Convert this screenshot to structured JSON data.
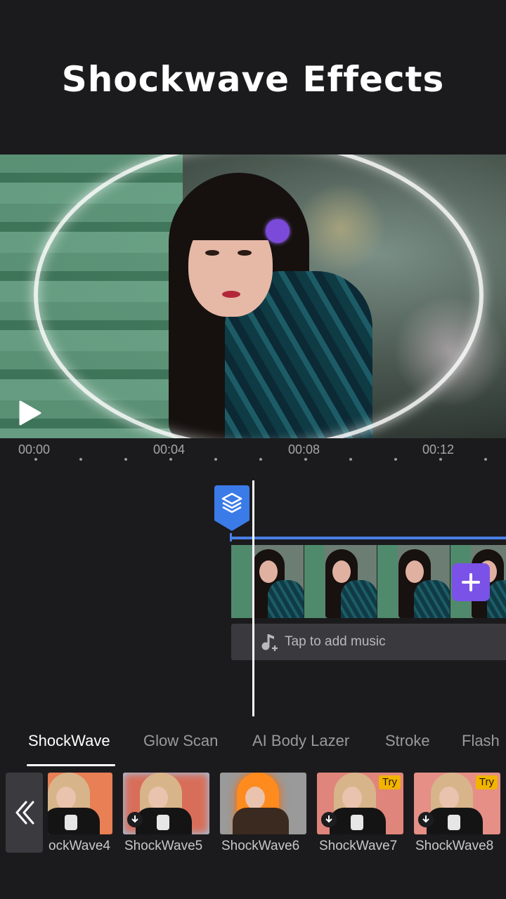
{
  "header": {
    "title": "Shockwave Effects"
  },
  "preview": {
    "play_icon": "play-icon"
  },
  "timeline": {
    "ticks": [
      "00:00",
      "00:04",
      "00:08",
      "00:12"
    ],
    "layer_icon": "layers-icon",
    "add_clip_icon": "plus-icon",
    "music_label": "Tap to add music",
    "music_icon": "music-note-add-icon"
  },
  "effects": {
    "tabs": [
      "ShockWave",
      "Glow Scan",
      "AI Body Lazer",
      "Stroke",
      "Flash"
    ],
    "active_tab": "ShockWave",
    "collapse_icon": "double-chevron-left-icon",
    "items": [
      {
        "label": "ockWave4",
        "badge": ""
      },
      {
        "label": "ShockWave5",
        "badge": "download"
      },
      {
        "label": "ShockWave6",
        "badge": ""
      },
      {
        "label": "ShockWave7",
        "badge": "download",
        "tag": "Try"
      },
      {
        "label": "ShockWave8",
        "badge": "download",
        "tag": "Try"
      }
    ]
  },
  "colors": {
    "accent_blue": "#4a7fe6",
    "accent_purple": "#7b52e8",
    "try_badge": "#f2b400",
    "background": "#1b1b1d"
  }
}
